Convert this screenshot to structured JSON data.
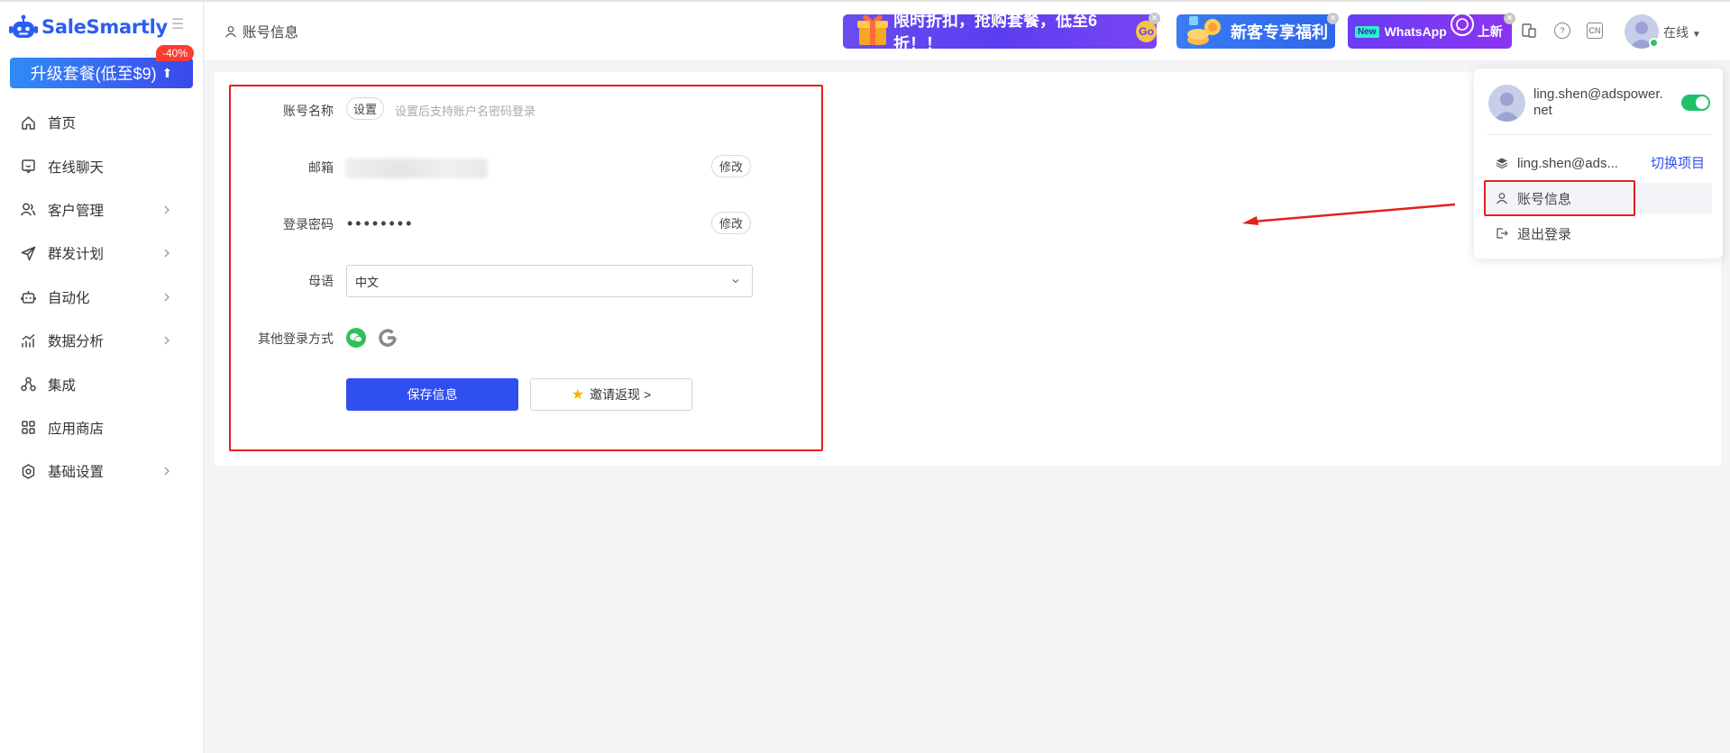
{
  "brand": {
    "name": "SaleSmartly"
  },
  "sidebar": {
    "upgrade_label": "升级套餐(低至$9)",
    "discount_badge": "-40%",
    "items": [
      {
        "label": "首页",
        "icon": "home-icon",
        "chevron": false
      },
      {
        "label": "在线聊天",
        "icon": "chat-icon",
        "chevron": false
      },
      {
        "label": "客户管理",
        "icon": "users-icon",
        "chevron": true
      },
      {
        "label": "群发计划",
        "icon": "send-icon",
        "chevron": true
      },
      {
        "label": "自动化",
        "icon": "robot-icon",
        "chevron": true
      },
      {
        "label": "数据分析",
        "icon": "chart-icon",
        "chevron": true
      },
      {
        "label": "集成",
        "icon": "integration-icon",
        "chevron": false
      },
      {
        "label": "应用商店",
        "icon": "apps-icon",
        "chevron": false
      },
      {
        "label": "基础设置",
        "icon": "settings-icon",
        "chevron": true
      }
    ]
  },
  "header": {
    "breadcrumb": "账号信息",
    "banner_discount": "限时折扣，抢购套餐，低至6折！！",
    "banner_go": "Go",
    "banner_newcomer": "新客专享福利",
    "banner_new_tag": "New",
    "banner_whatsapp": "WhatsApp",
    "banner_whatsapp_suffix": "上新",
    "lang_icon_text": "CN",
    "help_icon_text": "?",
    "status_text": "在线"
  },
  "form": {
    "account_name_label": "账号名称",
    "set_button": "设置",
    "account_name_hint": "设置后支持账户名密码登录",
    "email_label": "邮箱",
    "email_edit": "修改",
    "password_label": "登录密码",
    "password_value": "••••••••",
    "password_edit": "修改",
    "language_label": "母语",
    "language_value": "中文",
    "other_login_label": "其他登录方式",
    "save_button": "保存信息",
    "invite_button": "邀请返现 >"
  },
  "user_panel": {
    "email": "ling.shen@adspower.net",
    "project_name": "ling.shen@ads...",
    "switch_project": "切换项目",
    "account_info": "账号信息",
    "logout": "退出登录"
  },
  "colors": {
    "primary": "#2f4ff0",
    "annotation_red": "#e61e1e",
    "online_green": "#21c16b"
  }
}
